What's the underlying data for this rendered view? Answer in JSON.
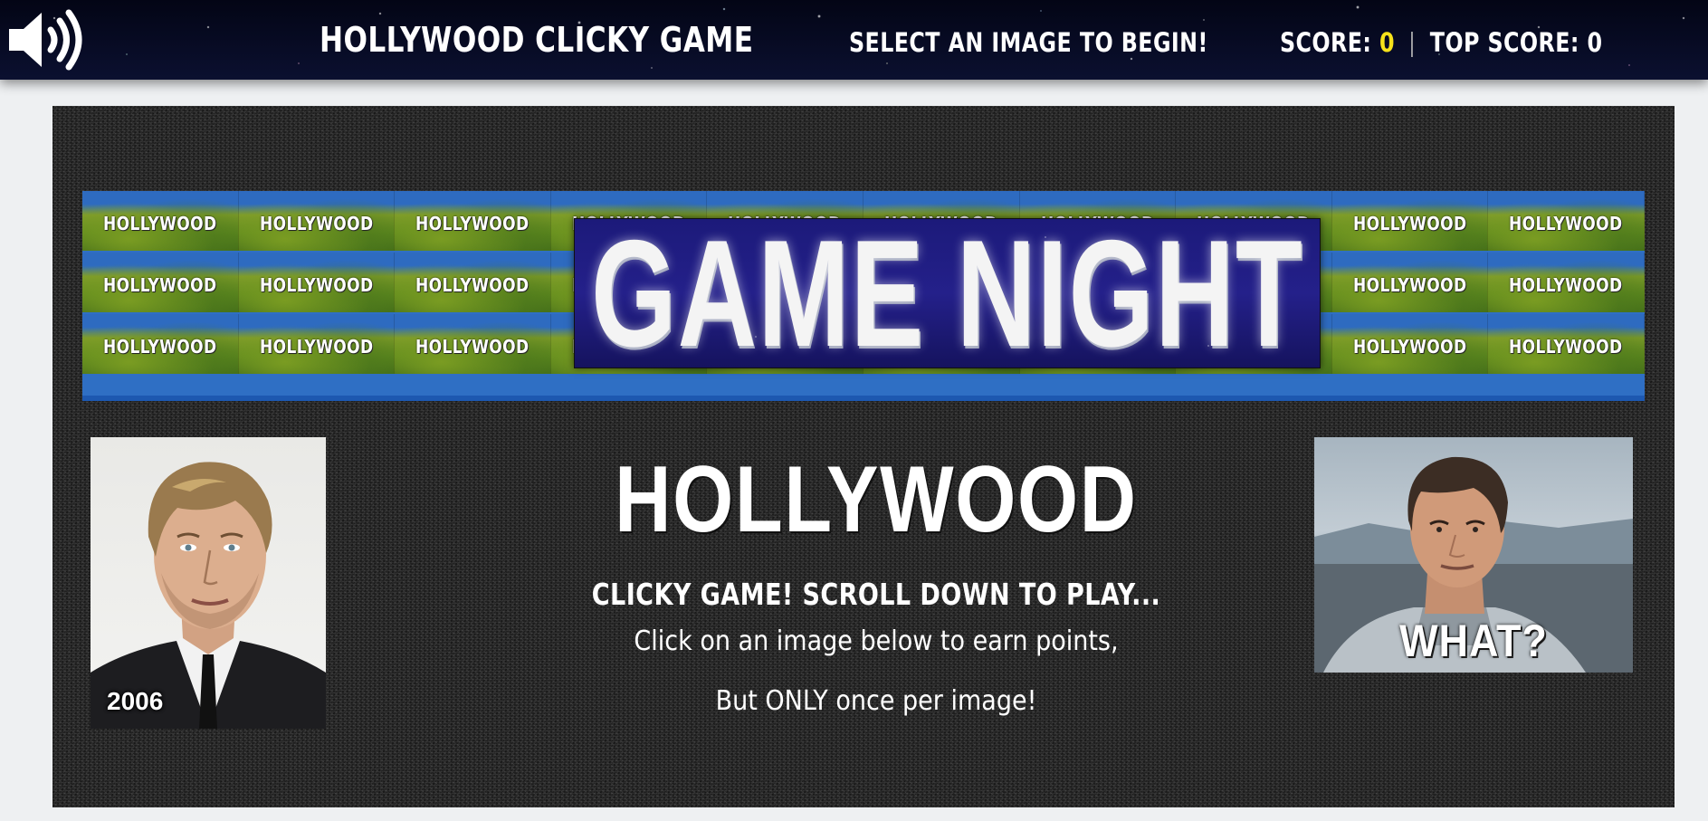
{
  "navbar": {
    "title": "Hollywood Clicky Game",
    "prompt": "Select an image to begin!",
    "score_label": "Score:",
    "score_value": "0",
    "top_score_label": "Top Score:",
    "top_score_value": "0",
    "sound_icon": "speaker-volume-icon"
  },
  "banner": {
    "tile_text": "HOLLYWOOD",
    "headline": "GAME NIGHT"
  },
  "main": {
    "title": "HOLLYWOOD",
    "subtitle": "Clicky Game! Scroll down to play...",
    "line1": "Click on an image below to earn points,",
    "line2": "But ONLY once per image!"
  },
  "images": {
    "left_caption": "2006",
    "right_caption": "WHAT?"
  }
}
